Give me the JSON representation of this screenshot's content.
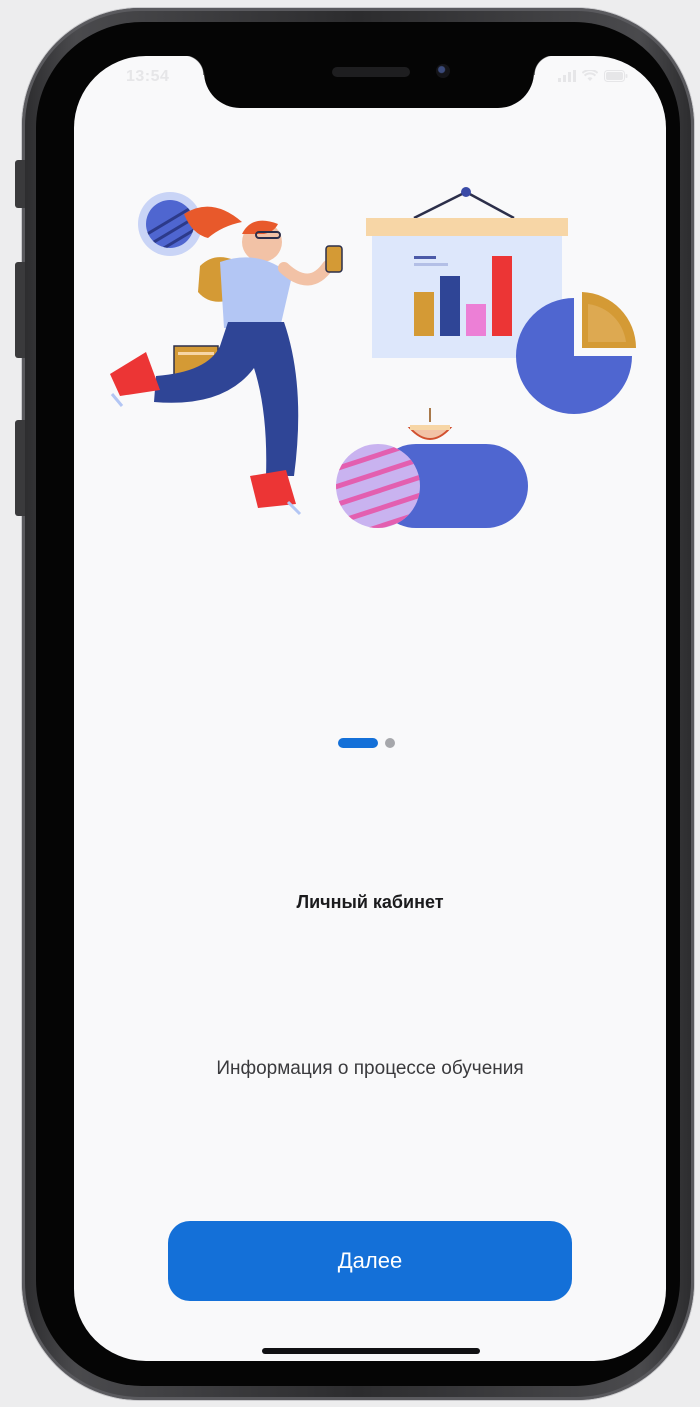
{
  "status_bar": {
    "time": "13:54",
    "icons": [
      "signal-icon",
      "wifi-icon",
      "battery-icon"
    ]
  },
  "illustration": {
    "icon": "student-running-with-charts-illustration"
  },
  "pager": {
    "pages": 2,
    "active_index": 0
  },
  "onboarding": {
    "title": "Личный кабинет",
    "subtitle": "Информация о процессе обучения",
    "next_label": "Далее"
  },
  "colors": {
    "accent": "#1470d8",
    "background": "#f9f9fa",
    "inactive_dot": "#a6a7ab"
  }
}
